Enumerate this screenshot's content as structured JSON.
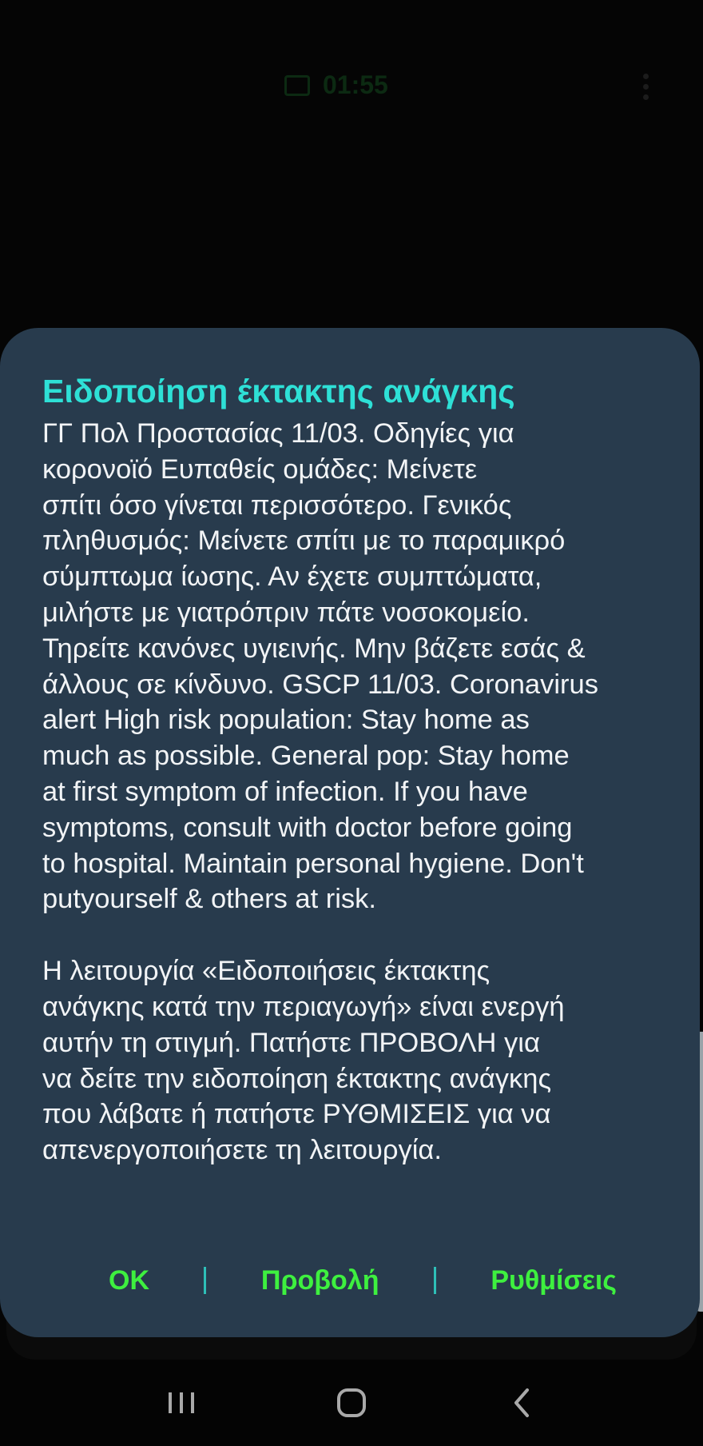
{
  "status_bar": {
    "time": "01:55"
  },
  "dialog": {
    "title": "Ειδοποίηση έκτακτης ανάγκης",
    "message_lines": [
      "ΓΓ Πολ Προστασίας 11/03. Οδηγίες για",
      "κορονοϊό Ευπαθείς ομάδες: Μείνετε",
      "σπίτι όσο γίνεται περισσότερο. Γενικός",
      "πληθυσμός: Μείνετε σπίτι με το παραμικρό",
      "σύμπτωμα ίωσης. Αν έχετε συμπτώματα,",
      "μιλήστε με γιατρόπριν πάτε νοσοκομείο.",
      "Τηρείτε κανόνες υγιεινής. Μην βάζετε εσάς &",
      "άλλους σε κίνδυνο. GSCP 11/03. Coronavirus",
      "alert High risk population: Stay home as",
      "much as possible. General pop: Stay home",
      "at first symptom of infection. If you have",
      "symptoms, consult with doctor before going",
      "to hospital. Maintain personal hygiene. Don't",
      "putyourself & others at risk."
    ],
    "info_lines": [
      "Η λειτουργία «Ειδοποιήσεις έκτακτης",
      "ανάγκης κατά την περιαγωγή» είναι ενεργή",
      "αυτήν τη στιγμή. Πατήστε ΠΡΟΒΟΛΗ για",
      "να δείτε την ειδοποίηση έκτακτης ανάγκης",
      "που λάβατε ή πατήστε ΡΥΘΜΙΣΕΙΣ για να",
      "απενεργοποιήσετε τη λειτουργία."
    ],
    "buttons": {
      "ok": "OK",
      "view": "Προβολή",
      "settings": "Ρυθμίσεις"
    }
  },
  "nav_bar": {
    "icons": [
      "recent-apps-icon",
      "home-icon",
      "back-icon"
    ]
  },
  "colors": {
    "dialog_background": "#283b4d",
    "title": "#2ee0d6",
    "body_text": "#f2f4f6",
    "action_text": "#3ef03f",
    "divider": "#2ebfb8"
  }
}
